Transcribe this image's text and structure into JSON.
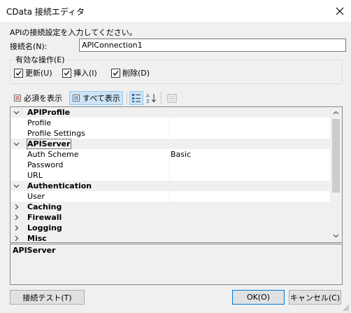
{
  "window": {
    "title": "CData 接続エディタ"
  },
  "intro": "APIの接続設定を入力してください。",
  "connection_name": {
    "label": "接続名(N):",
    "value": "APIConnection1"
  },
  "operations": {
    "legend": "有効な操作(E)",
    "items": [
      {
        "label": "更新(U)",
        "checked": true
      },
      {
        "label": "挿入(I)",
        "checked": true
      },
      {
        "label": "削除(D)",
        "checked": true
      }
    ]
  },
  "toolbar": {
    "required_label": "必須を表示",
    "all_label": "すべて表示"
  },
  "grid": {
    "rows": [
      {
        "type": "category",
        "name": "APIProfile",
        "expanded": true
      },
      {
        "type": "prop",
        "name": "Profile",
        "value": ""
      },
      {
        "type": "prop",
        "name": "Profile Settings",
        "value": ""
      },
      {
        "type": "category",
        "name": "APIServer",
        "expanded": true,
        "selected": true
      },
      {
        "type": "prop",
        "name": "Auth Scheme",
        "value": "Basic"
      },
      {
        "type": "prop",
        "name": "Password",
        "value": ""
      },
      {
        "type": "prop",
        "name": "URL",
        "value": ""
      },
      {
        "type": "category",
        "name": "Authentication",
        "expanded": true
      },
      {
        "type": "prop",
        "name": "User",
        "value": ""
      },
      {
        "type": "category",
        "name": "Caching",
        "expanded": false
      },
      {
        "type": "category",
        "name": "Firewall",
        "expanded": false
      },
      {
        "type": "category",
        "name": "Logging",
        "expanded": false
      },
      {
        "type": "category",
        "name": "Misc",
        "expanded": false
      }
    ]
  },
  "description": {
    "title": "APIServer"
  },
  "buttons": {
    "test": "接続テスト(T)",
    "ok": "OK(O)",
    "cancel": "キャンセル(C)"
  }
}
